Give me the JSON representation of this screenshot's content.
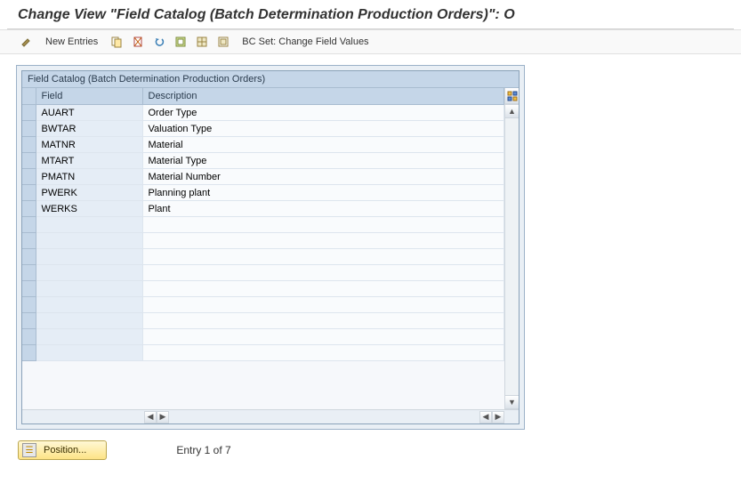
{
  "title": "Change View \"Field Catalog (Batch Determination Production Orders)\": O",
  "toolbar": {
    "new_entries": "New Entries",
    "bc_set": "BC Set: Change Field Values"
  },
  "table": {
    "caption": "Field Catalog (Batch Determination Production Orders)",
    "columns": {
      "field": "Field",
      "description": "Description"
    },
    "rows": [
      {
        "field": "AUART",
        "description": "Order Type"
      },
      {
        "field": "BWTAR",
        "description": "Valuation Type"
      },
      {
        "field": "MATNR",
        "description": "Material"
      },
      {
        "field": "MTART",
        "description": "Material Type"
      },
      {
        "field": "PMATN",
        "description": "Material Number"
      },
      {
        "field": "PWERK",
        "description": "Planning plant"
      },
      {
        "field": "WERKS",
        "description": "Plant"
      }
    ],
    "empty_row_count": 9
  },
  "footer": {
    "position_label": "Position...",
    "entry_text": "Entry 1 of 7"
  }
}
